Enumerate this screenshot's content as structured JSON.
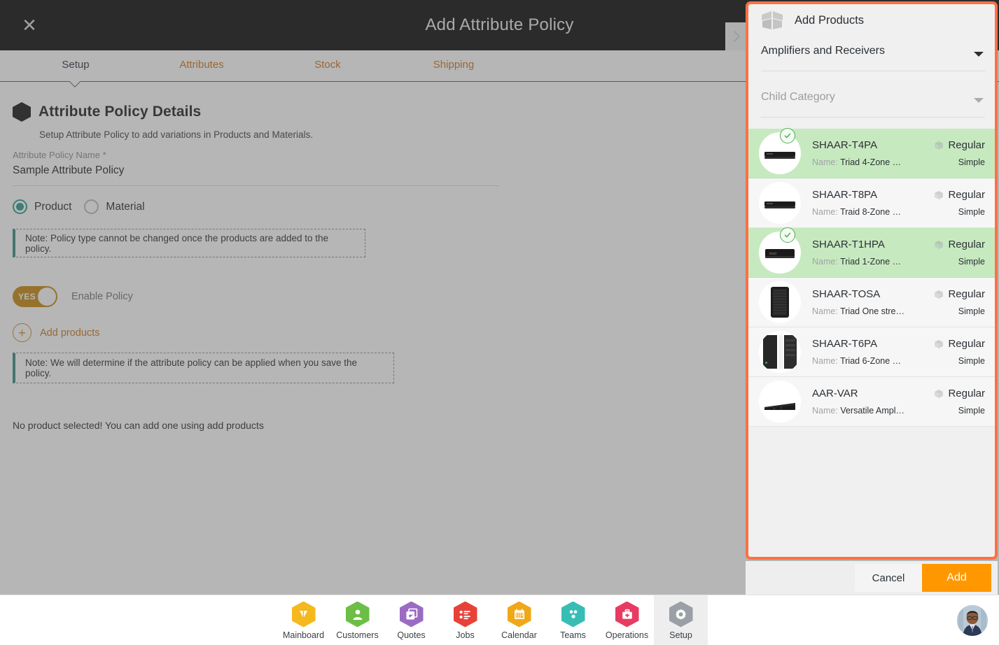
{
  "header": {
    "title": "Add Attribute Policy",
    "close_icon": "close-icon",
    "next_icon": "chevron-right-icon"
  },
  "tabs": [
    {
      "label": "Setup",
      "active": true
    },
    {
      "label": "Attributes",
      "active": false
    },
    {
      "label": "Stock",
      "active": false
    },
    {
      "label": "Shipping",
      "active": false
    }
  ],
  "form": {
    "section_title": "Attribute Policy Details",
    "section_subtitle": "Setup Attribute Policy to add variations in Products and Materials.",
    "name_label": "Attribute Policy Name *",
    "name_value": "Sample Attribute Policy",
    "policy_type": [
      {
        "label": "Product",
        "selected": true
      },
      {
        "label": "Material",
        "selected": false
      }
    ],
    "note_policy_type": "Note: Policy type cannot be changed once the products are added to the policy.",
    "toggle_state": "YES",
    "toggle_label": "Enable Policy",
    "add_products_label": "Add products",
    "note_save": "Note: We will determine if the attribute policy can be applied when you save the policy.",
    "empty_message": "No product selected! You can add one using add products"
  },
  "panel": {
    "title": "Add Products",
    "icon": "open-box-icon",
    "parent_category": {
      "value": "Amplifiers and Receivers",
      "placeholder": "Parent Category"
    },
    "child_category": {
      "value": "",
      "placeholder": "Child Category"
    },
    "products": [
      {
        "sku": "SHAAR-T4PA",
        "name_label": "Name:",
        "name": "Triad 4-Zone …",
        "type": "Regular",
        "variant": "Simple",
        "selected": true,
        "thumb": "soundbar-black"
      },
      {
        "sku": "SHAAR-T8PA",
        "name_label": "Name:",
        "name": "Traid 8-Zone …",
        "type": "Regular",
        "variant": "Simple",
        "selected": false,
        "thumb": "soundbar-black"
      },
      {
        "sku": "SHAAR-T1HPA",
        "name_label": "Name:",
        "name": "Triad 1-Zone …",
        "type": "Regular",
        "variant": "Simple",
        "selected": true,
        "thumb": "amp-black"
      },
      {
        "sku": "SHAAR-TOSA",
        "name_label": "Name:",
        "name": "Triad One stre…",
        "type": "Regular",
        "variant": "Simple",
        "selected": false,
        "thumb": "tower-black"
      },
      {
        "sku": "SHAAR-T6PA",
        "name_label": "Name:",
        "name": "Triad 6-Zone …",
        "type": "Regular",
        "variant": "Simple",
        "selected": false,
        "thumb": "rack-black"
      },
      {
        "sku": "AAR-VAR",
        "name_label": "Name:",
        "name": "Versatile Ampl…",
        "type": "Regular",
        "variant": "Simple",
        "selected": false,
        "thumb": "wedge-black"
      }
    ],
    "cancel_label": "Cancel",
    "add_label": "Add"
  },
  "bottom_nav": [
    {
      "label": "Mainboard",
      "icon": "mainboard-icon",
      "color": "#f5b81d",
      "active": false
    },
    {
      "label": "Customers",
      "icon": "customers-icon",
      "color": "#6cbe45",
      "active": false
    },
    {
      "label": "Quotes",
      "icon": "quotes-icon",
      "color": "#9b6bc4",
      "active": false
    },
    {
      "label": "Jobs",
      "icon": "jobs-icon",
      "color": "#e8413a",
      "active": false
    },
    {
      "label": "Calendar",
      "icon": "calendar-icon",
      "color": "#f0a818",
      "active": false
    },
    {
      "label": "Teams",
      "icon": "teams-icon",
      "color": "#38bdb5",
      "active": false
    },
    {
      "label": "Operations",
      "icon": "operations-icon",
      "color": "#e83b62",
      "active": false
    },
    {
      "label": "Setup",
      "icon": "gear-icon",
      "color": "#9aa0a6",
      "active": true
    }
  ],
  "colors": {
    "accent_orange": "#ff7043",
    "add_button": "#ff9800",
    "selected_row": "#c7e9c0",
    "teal": "#3b8d84",
    "toggle_on": "#c98a12",
    "topbar": "#111111"
  }
}
